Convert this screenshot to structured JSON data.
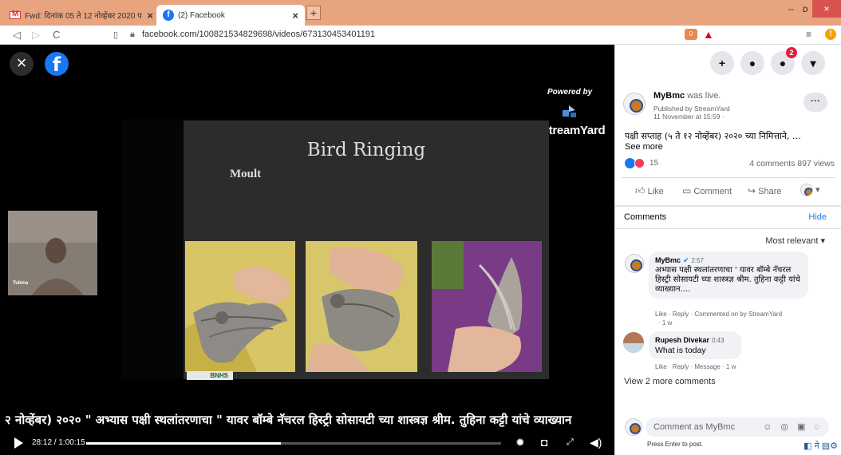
{
  "browser": {
    "tabs": [
      {
        "title": "Fwd: दिनांक 05 ते 12 नोव्हेंबर 2020 प",
        "close": "×",
        "icon": "gmail-icon"
      },
      {
        "title": "(2) Facebook",
        "close": "×",
        "icon": "facebook-icon"
      }
    ],
    "new_tab": "+",
    "window": {
      "minimize": "–",
      "maximize": "ᴅ",
      "close": "×"
    },
    "nav": {
      "back": "◁",
      "forward": "▷",
      "reload": "C"
    },
    "url": "facebook.com/100821534829698/videos/673130453401191"
  },
  "video": {
    "close_label": "×",
    "fb_label": "f",
    "powered_by": "Powered by",
    "brand": "StreamYard",
    "slide_title": "Bird Ringing",
    "slide_subtitle": "Moult",
    "slide_logo_text": "BNHS",
    "participant_name": "Tuhina",
    "ticker": "२ नोव्हेंबर) २०२० \" अभ्यास पक्षी स्थलांतरणाचा \" यावर बॉम्बे नॅचरल हिस्ट्री सोसायटी च्या शास्त्रज्ञ श्रीम. तुहिना कट्टी यांचे व्याख्यान",
    "time": "28:12 / 1:00:15",
    "progress": 0.469,
    "controls": [
      "settings-icon",
      "miniplayer-icon",
      "fullscreen-icon",
      "volume-icon"
    ]
  },
  "panel": {
    "top_icons": [
      {
        "name": "create-icon",
        "label": "+"
      },
      {
        "name": "messenger-icon",
        "label": "●"
      },
      {
        "name": "notifications-icon",
        "label": "●",
        "badge": "2"
      },
      {
        "name": "account-menu-icon",
        "label": "▾"
      }
    ],
    "post": {
      "page_name": "MyBmc",
      "status": "was live.",
      "published_by": "Published by StreamYard",
      "date": "11 November at 15:59 ·",
      "more": "···",
      "text": "पक्षी सप्ताह (५ ते १२ नोव्हेंबर) २०२० च्या निमित्ताने, …",
      "see_more": "See more",
      "reaction_count": "15",
      "stats": "4 comments 897 views"
    },
    "actions": {
      "like": "Like",
      "comment": "Comment",
      "share": "Share"
    },
    "comments_heading": "Comments",
    "hide": "Hide",
    "sort": "Most relevant ▾",
    "comments": [
      {
        "name": "MyBmc",
        "time": "2:57",
        "text": "अभ्यास पक्षी स्थलांतरणाचा ' यावर बॉम्बे नॅचरल हिस्ट्री सोसायटी च्या शास्त्रज्ञ श्रीम. तुहिना कट्टी यांचे व्याख्यान....",
        "meta": "Like · Reply · Commented on by StreamYard",
        "age": "· 1 w"
      },
      {
        "name": "Rupesh Divekar",
        "time": "0:43",
        "text": "What is today",
        "meta": "Like · Reply · Message · 1 w"
      }
    ],
    "view_more": "View 2 more comments",
    "compose_placeholder": "Comment as MyBmc",
    "compose_icons": "☺ ◎ ▣ ◌",
    "press_enter": "Press Enter to post.",
    "tray": "◧ ने ▤⚙"
  },
  "colors": {
    "tab_bar": "#e8a37f",
    "facebook_blue": "#1877f2",
    "badge_red": "#e41e3f"
  }
}
